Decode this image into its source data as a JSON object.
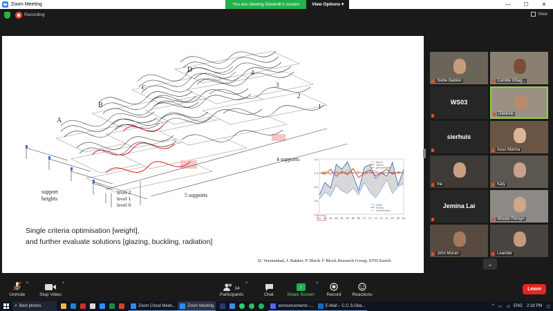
{
  "window": {
    "title": "Zoom Meeting",
    "minimize": "—",
    "maximize": "☐",
    "close": "✕"
  },
  "share_banner": {
    "text": "You are viewing Diederik's screen",
    "options": "View Options ▾"
  },
  "topbar": {
    "recording": "Recording",
    "view": "View"
  },
  "slide": {
    "letters": [
      "A",
      "B",
      "C",
      "D"
    ],
    "numbers": [
      "1",
      "2",
      "3",
      "4"
    ],
    "support_label_1": "support",
    "support_label_2": "heights",
    "levels": [
      "level 2",
      "level 1",
      "level 0"
    ],
    "label_4_supports": "4 supports",
    "label_5_supports": "5 supports",
    "caption_line1": "Single criteria optimisation [weight],",
    "caption_line2": "and further evaluate solutions [glazing, buckling, radiation]",
    "credit": "D. Veenendaal, J. Bakker, P. Block © Block Research Group, ETH Zurich"
  },
  "chart_data": {
    "type": "line",
    "title": "",
    "legend_top": [
      "glazing",
      "radiation",
      "glazing/radiation"
    ],
    "legend_bottom": [
      "weight",
      "buckling",
      "weight/buckling"
    ],
    "y_ticks": [
      "1.2",
      "1.0",
      "0.8",
      "0.6",
      "0.4"
    ],
    "x_ticks": [
      "A1",
      "A2",
      "A3",
      "A4",
      "B1",
      "B2",
      "B3",
      "B4",
      "C1",
      "C2",
      "C3",
      "C4",
      "D1",
      "D2",
      "D3",
      "D4"
    ],
    "series": [
      {
        "name": "glazing",
        "color": "#d83b2a",
        "values": [
          1.0,
          0.98,
          1.05,
          0.95,
          1.02,
          0.97,
          1.06,
          0.93,
          1.0,
          1.04,
          0.96,
          1.0,
          1.05,
          0.98,
          1.01,
          1.0
        ]
      },
      {
        "name": "radiation",
        "color": "#f0a080",
        "values": [
          0.99,
          1.02,
          0.97,
          1.03,
          0.98,
          1.04,
          0.99,
          1.02,
          0.97,
          1.01,
          1.03,
          0.98,
          1.0,
          1.02,
          0.99,
          1.01
        ]
      },
      {
        "name": "weight",
        "color": "#3a6fc4",
        "values": [
          0.68,
          0.86,
          0.78,
          1.12,
          1.05,
          1.16,
          0.96,
          0.74,
          1.08,
          1.12,
          0.92,
          1.0,
          0.95,
          1.15,
          0.82,
          1.05
        ]
      },
      {
        "name": "buckling",
        "color": "#8fb6e6",
        "values": [
          0.62,
          0.72,
          0.66,
          0.82,
          0.74,
          0.7,
          0.78,
          0.68,
          0.86,
          0.72,
          0.64,
          0.76,
          0.9,
          0.7,
          0.8,
          0.84
        ]
      }
    ]
  },
  "participants": [
    {
      "name": "Siebe Bakker",
      "kind": "photo"
    },
    {
      "name": "Camille Gbag...",
      "kind": "photo"
    },
    {
      "name": "",
      "big": "WS03",
      "kind": "text"
    },
    {
      "name": "Diederik",
      "kind": "photo",
      "active": true
    },
    {
      "name": "",
      "big": "sierhuis",
      "kind": "text"
    },
    {
      "name": "Asus Marina",
      "kind": "photo"
    },
    {
      "name": "Ine",
      "kind": "photo"
    },
    {
      "name": "Katy",
      "kind": "photo"
    },
    {
      "name": "",
      "big": "Jemina Lai",
      "kind": "text"
    },
    {
      "name": "Wouter Persyn",
      "kind": "photo"
    },
    {
      "name": "John Moran",
      "kind": "photo"
    },
    {
      "name": "Leander",
      "kind": "photo"
    }
  ],
  "toolbar": {
    "unmute": "Unmute",
    "stop_video": "Stop Video",
    "participants": "Participants",
    "participant_count": "34",
    "chat": "Chat",
    "share_screen": "Share Screen",
    "record": "Record",
    "reactions": "Reactions",
    "leave": "Leave"
  },
  "taskbar": {
    "search_text": "Best photos",
    "tasks": [
      "Zoom Cloud Meeti...",
      "Zoom Meeting",
      "announcements -...",
      "E-Mail – C.C.S.Gba..."
    ],
    "lang": "ENG",
    "time": "2:18 PM"
  }
}
